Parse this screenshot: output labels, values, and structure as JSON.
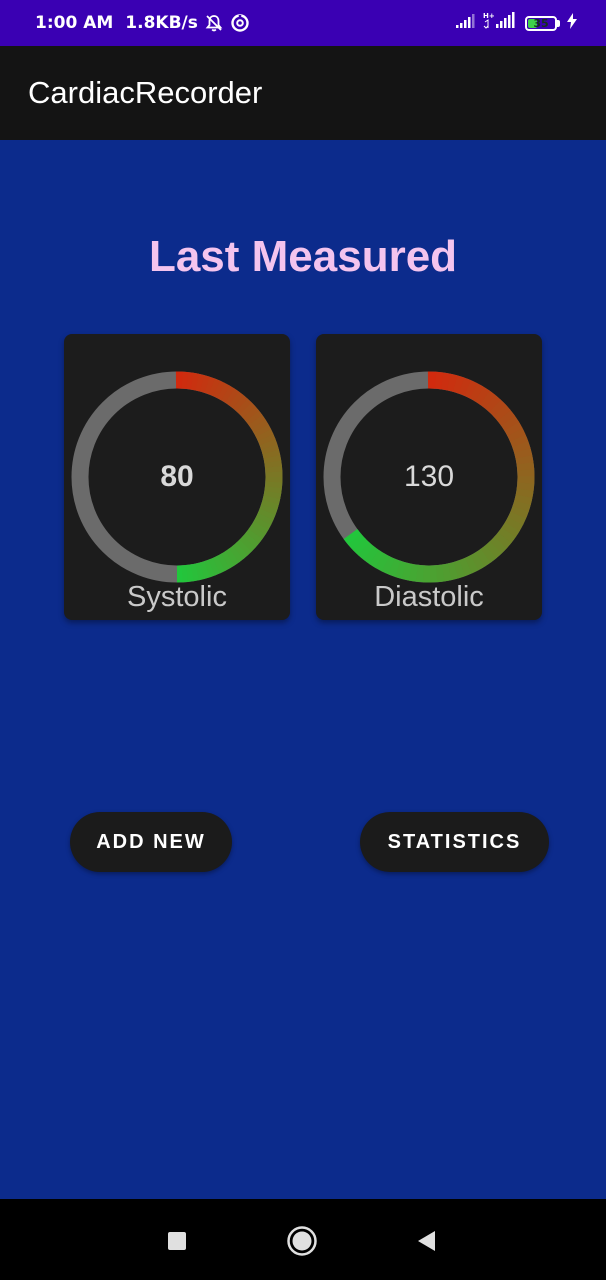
{
  "status_bar": {
    "time": "1:00 AM",
    "speed": "1.8KB/s",
    "battery": "35",
    "battery_level": 0.35,
    "network_type": "H+",
    "icons": [
      "notifications-off-icon",
      "data-saver-icon",
      "signal-icon",
      "signal-h-plus-icon",
      "battery-icon",
      "charging-bolt-icon"
    ]
  },
  "app_bar": {
    "title": "CardiacRecorder"
  },
  "main": {
    "heading": "Last Measured",
    "gauges": [
      {
        "label": "Systolic",
        "value": "80",
        "value_bold": true,
        "level": 0.5
      },
      {
        "label": "Diastolic",
        "value": "130",
        "value_bold": false,
        "level": 0.65
      }
    ],
    "gauge_colors": {
      "start": "#22c63c",
      "end": "#d12a0e",
      "track": "#6b6b6b"
    },
    "buttons": {
      "add_new": "ADD NEW",
      "statistics": "STATISTICS"
    }
  },
  "nav_bar": {
    "icons": [
      "recent-apps-icon",
      "home-icon",
      "back-icon"
    ]
  },
  "colors": {
    "background": "#0c2b8c",
    "status_bar": "#3a00b3",
    "app_bar": "#141414",
    "heading": "#f4c4ee",
    "card": "#1c1c1c"
  }
}
